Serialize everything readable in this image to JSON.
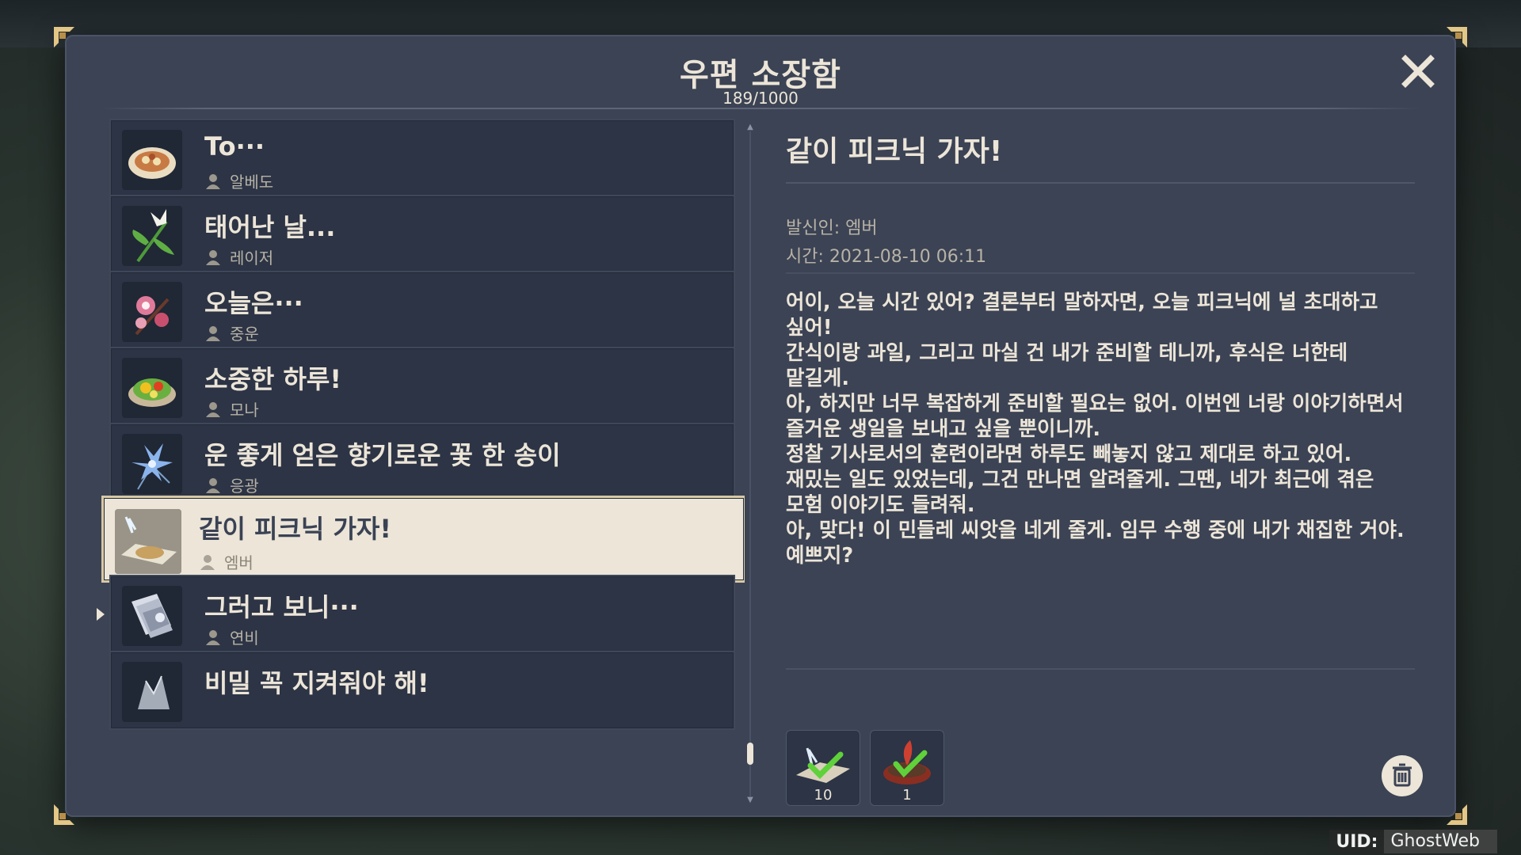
{
  "window": {
    "title": "우편 소장함",
    "count": "189/1000",
    "close_icon": "close-x-icon"
  },
  "mail_list": [
    {
      "subject": "To···",
      "sender": "알베도",
      "icon": "food-plate-icon"
    },
    {
      "subject": "태어난 날...",
      "sender": "레이저",
      "icon": "lily-flower-icon"
    },
    {
      "subject": "오늘은···",
      "sender": "중운",
      "icon": "pink-flower-branch-icon"
    },
    {
      "subject": "소중한 하루!",
      "sender": "모나",
      "icon": "salad-plate-icon"
    },
    {
      "subject": "운 좋게 얻은 향기로운 꽃 한 송이",
      "sender": "응광",
      "icon": "blue-glaze-lily-icon"
    },
    {
      "subject": "같이 피크닉 가자!",
      "sender": "엠버",
      "icon": "dough-tray-icon",
      "selected": true
    },
    {
      "subject": "그러고 보니···",
      "sender": "연비",
      "icon": "paper-stack-icon"
    },
    {
      "subject": "비밀 꼭 지켜줘야 해!",
      "sender": "",
      "icon": "crystal-icon"
    }
  ],
  "detail": {
    "subject": "같이 피크닉 가자!",
    "from": "발신인: 엠버",
    "time": "시간: 2021-08-10 06:11",
    "body": "어이, 오늘 시간 있어? 결론부터 말하자면, 오늘 피크닉에 널 초대하고\n싶어!\n간식이랑 과일, 그리고 마실 건 내가 준비할 테니까, 후식은 너한테\n맡길게.\n아, 하지만 너무 복잡하게 준비할 필요는 없어. 이번엔 너랑 이야기하면서\n즐거운 생일을 보내고 싶을 뿐이니까.\n정찰 기사로서의 훈련이라면 하루도 빼놓지 않고 제대로 하고 있어.\n재밌는 일도 있었는데, 그건 만나면 알려줄게. 그땐, 네가 최근에 겪은\n모험 이야기도 들려줘.\n아, 맞다! 이 민들레 씨앗을 네게 줄게. 임무 수행 중에 내가 채집한 거야.\n예쁘지?",
    "attachments": [
      {
        "qty": "10",
        "icon": "recipe-scroll-icon",
        "claimed": true
      },
      {
        "qty": "1",
        "icon": "seed-pot-icon",
        "claimed": true
      }
    ],
    "delete_icon": "trash-icon"
  },
  "uid": {
    "label": "UID:",
    "value": "GhostWeb"
  },
  "colors": {
    "panel_bg": "#3b4354",
    "item_bg": "#2c3445",
    "text_light": "#ece5d8",
    "text_muted": "#b8b2a6",
    "selected_bg": "#ece5d8",
    "check_green": "#5fd13a"
  }
}
